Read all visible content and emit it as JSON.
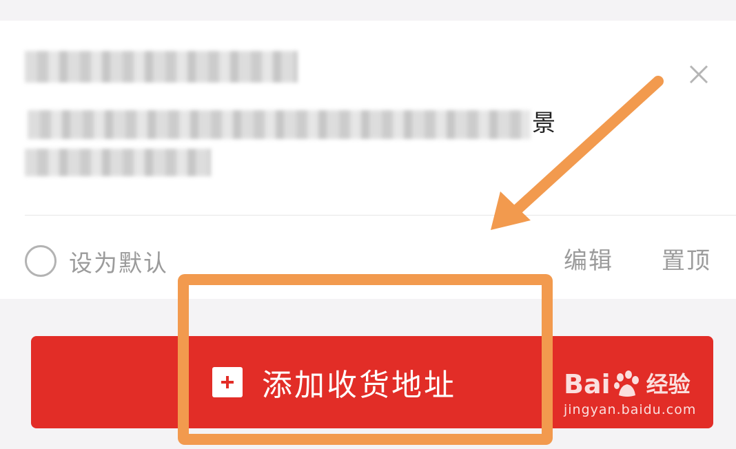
{
  "address_card": {
    "address_visible_tail": "景",
    "default_label": "设为默认",
    "edit_label": "编辑",
    "pin_top_label": "置顶"
  },
  "add_button": {
    "label": "添加收货地址"
  },
  "watermark": {
    "brand_left": "Bai",
    "brand_right": "经验",
    "url": "jingyan.baidu.com"
  },
  "colors": {
    "primary_red": "#e22d27",
    "annotation_orange": "#f29a4e",
    "muted_text": "#9b9b9b",
    "background": "#f4f3f5"
  },
  "icons": [
    "close-icon",
    "radio-circle-icon",
    "plus-icon",
    "annotation-arrow-icon",
    "baidu-paw-icon"
  ]
}
